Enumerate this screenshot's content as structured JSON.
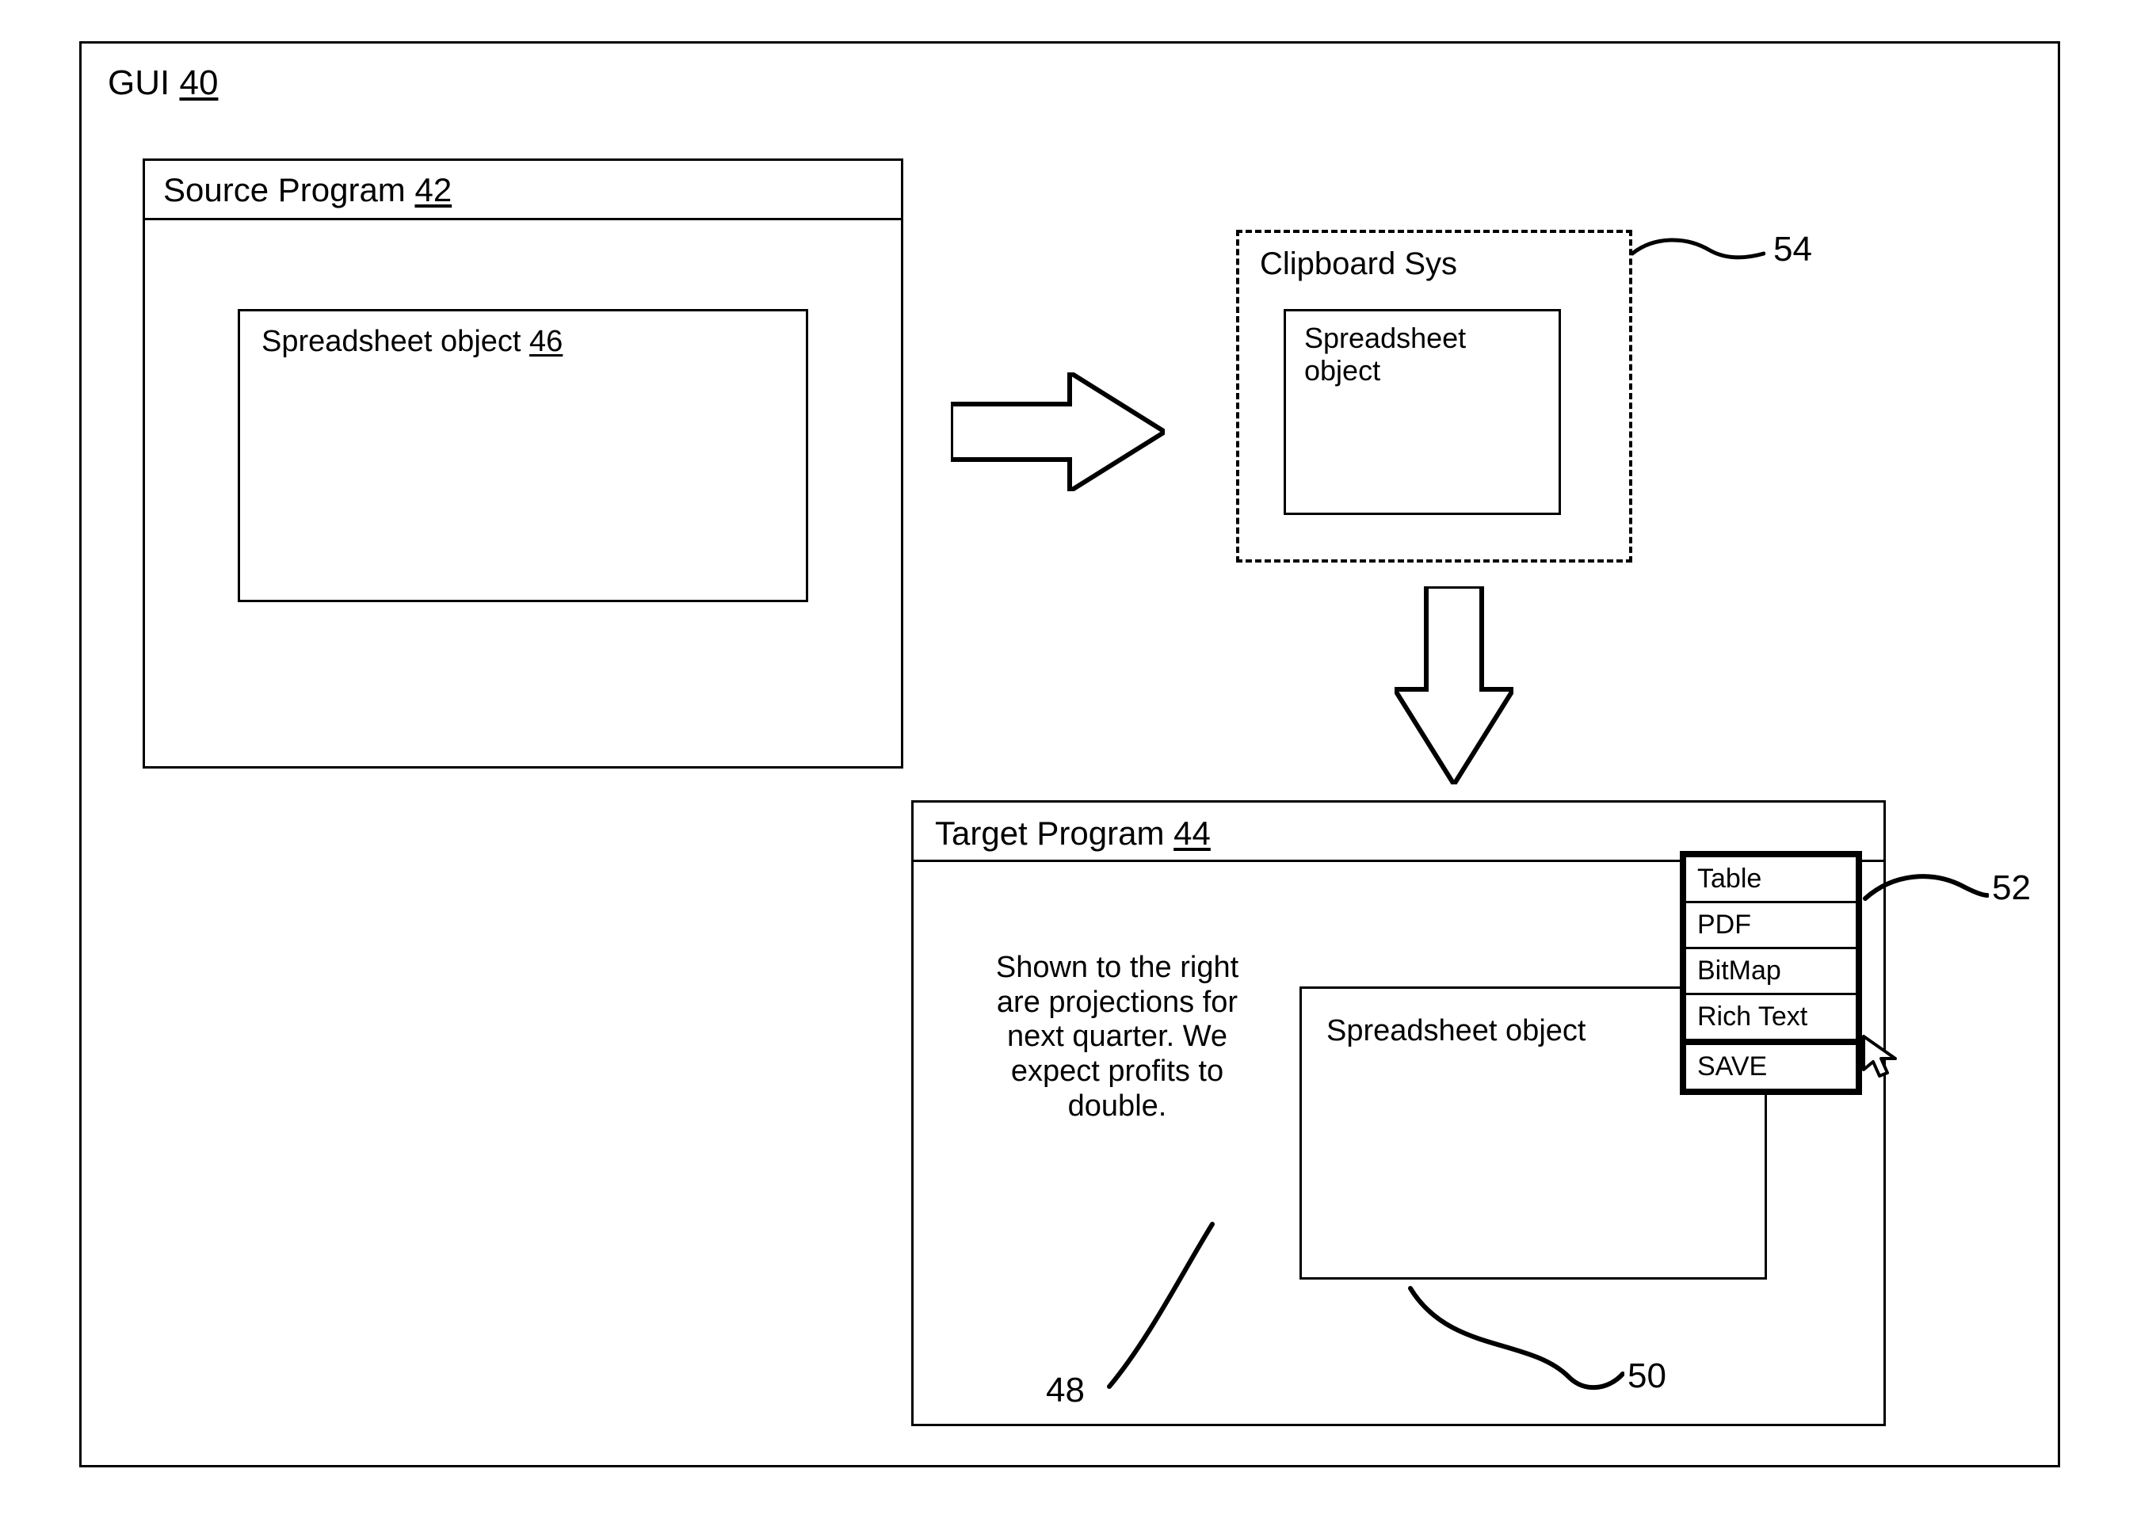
{
  "gui": {
    "label": "GUI",
    "ref": "40"
  },
  "source_program": {
    "title": "Source Program",
    "ref": "42",
    "object_label": "Spreadsheet object",
    "object_ref": "46"
  },
  "clipboard": {
    "title": "Clipboard Sys",
    "ref": "54",
    "object_label": "Spreadsheet object"
  },
  "target_program": {
    "title": "Target Program",
    "ref": "44",
    "body_text": "Shown to the right are projections for next quarter.  We expect profits to double.",
    "body_ref": "48",
    "object_label": "Spreadsheet object",
    "object_ref": "50"
  },
  "paste_menu": {
    "ref": "52",
    "items": [
      "Table",
      "PDF",
      "BitMap",
      "Rich Text",
      "SAVE"
    ]
  }
}
